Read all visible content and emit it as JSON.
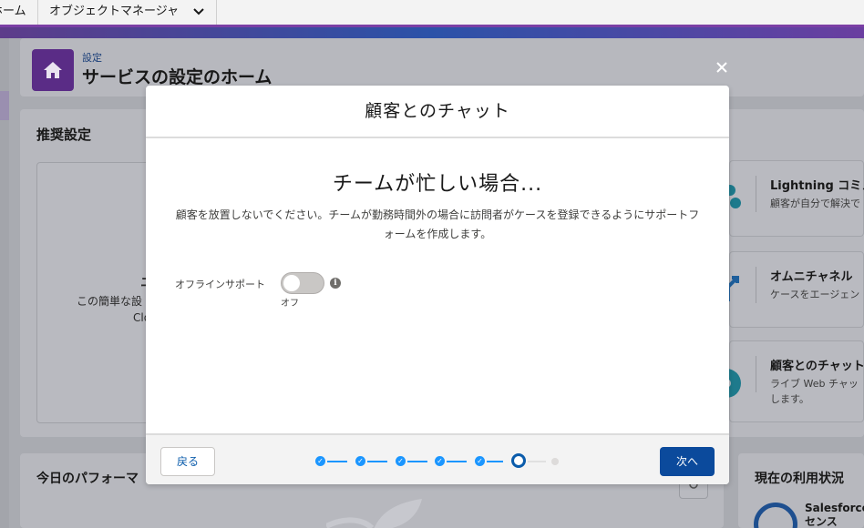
{
  "nav": {
    "home_tab": "ホーム",
    "object_manager_tab": "オブジェクトマネージャ"
  },
  "header": {
    "breadcrumb": "設定",
    "title": "サービスの設定のホーム"
  },
  "recommended": {
    "title": "推奨設定",
    "card_text_1": "この簡単な設",
    "card_text_2": "Clo"
  },
  "right_cards": [
    {
      "title": "Lightning コミュ",
      "subtitle": "顧客が自分で解決で",
      "icon": "community-icon"
    },
    {
      "title": "オムニチャネル",
      "subtitle": "ケースをエージェン",
      "icon": "routing-icon"
    },
    {
      "title": "顧客とのチャット",
      "subtitle": "ライブ Web チャッ\nします。",
      "icon": "chat-icon"
    }
  ],
  "performance": {
    "title": "今日のパフォーマ"
  },
  "usage": {
    "title": "現在の利用状況",
    "label": "Salesforce\nセンス"
  },
  "modal": {
    "title": "顧客とのチャット",
    "heading": "チームが忙しい場合...",
    "description": "顧客を放置しないでください。チームが勤務時間外の場合に訪問者がケースを登録できるようにサポートフォームを作成します。",
    "toggle": {
      "label": "オフラインサポート",
      "state": "オフ",
      "enabled": false
    },
    "back_label": "戻る",
    "next_label": "次へ",
    "progress": {
      "total_steps": 7,
      "completed_steps": 5,
      "current_step": 6
    }
  },
  "colors": {
    "brand_purple": "#5a2c86",
    "primary_button": "#0b4a9c",
    "progress_complete": "#1b96ff"
  }
}
